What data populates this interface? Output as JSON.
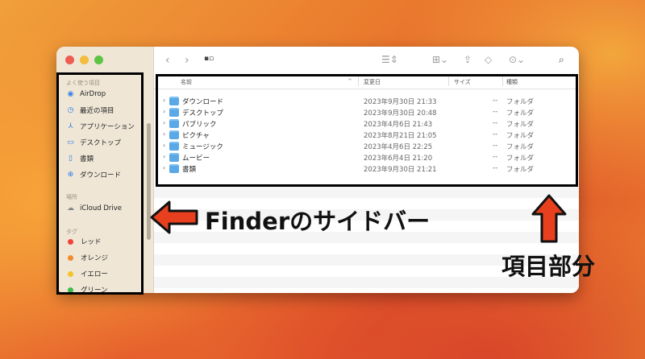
{
  "sidebar": {
    "favorites_title": "よく使う項目",
    "favorites": [
      {
        "label": "AirDrop",
        "icon": "airdrop-icon"
      },
      {
        "label": "最近の項目",
        "icon": "clock-icon"
      },
      {
        "label": "アプリケーション",
        "icon": "applications-icon"
      },
      {
        "label": "デスクトップ",
        "icon": "desktop-icon"
      },
      {
        "label": "書類",
        "icon": "document-icon"
      },
      {
        "label": "ダウンロード",
        "icon": "download-icon"
      }
    ],
    "locations_title": "場所",
    "locations": [
      {
        "label": "iCloud Drive",
        "icon": "cloud-icon"
      }
    ],
    "tags_title": "タグ",
    "tags": [
      {
        "label": "レッド",
        "color": "#f0433a"
      },
      {
        "label": "オレンジ",
        "color": "#f38b2d"
      },
      {
        "label": "イエロー",
        "color": "#f4c22b"
      },
      {
        "label": "グリーン",
        "color": "#3dbb4f"
      }
    ]
  },
  "columns": {
    "name": "名前",
    "date": "変更日",
    "size": "サイズ",
    "kind": "種類"
  },
  "files": [
    {
      "name": "ダウンロード",
      "date": "2023年9月30日 21:33",
      "size": "--",
      "kind": "フォルダ"
    },
    {
      "name": "デスクトップ",
      "date": "2023年9月30日 20:48",
      "size": "--",
      "kind": "フォルダ"
    },
    {
      "name": "パブリック",
      "date": "2023年4月6日 21:43",
      "size": "--",
      "kind": "フォルダ"
    },
    {
      "name": "ピクチャ",
      "date": "2023年8月21日 21:05",
      "size": "--",
      "kind": "フォルダ"
    },
    {
      "name": "ミュージック",
      "date": "2023年4月6日 22:25",
      "size": "--",
      "kind": "フォルダ"
    },
    {
      "name": "ムービー",
      "date": "2023年6月4日 21:20",
      "size": "--",
      "kind": "フォルダ"
    },
    {
      "name": "書類",
      "date": "2023年9月30日 21:21",
      "size": "--",
      "kind": "フォルダ"
    }
  ],
  "annotations": {
    "sidebar_label": "Finderのサイドバー",
    "items_label": "項目部分"
  },
  "colors": {
    "highlight": "#000000",
    "arrow": "#e8401f",
    "folder": "#5aa9e6"
  }
}
